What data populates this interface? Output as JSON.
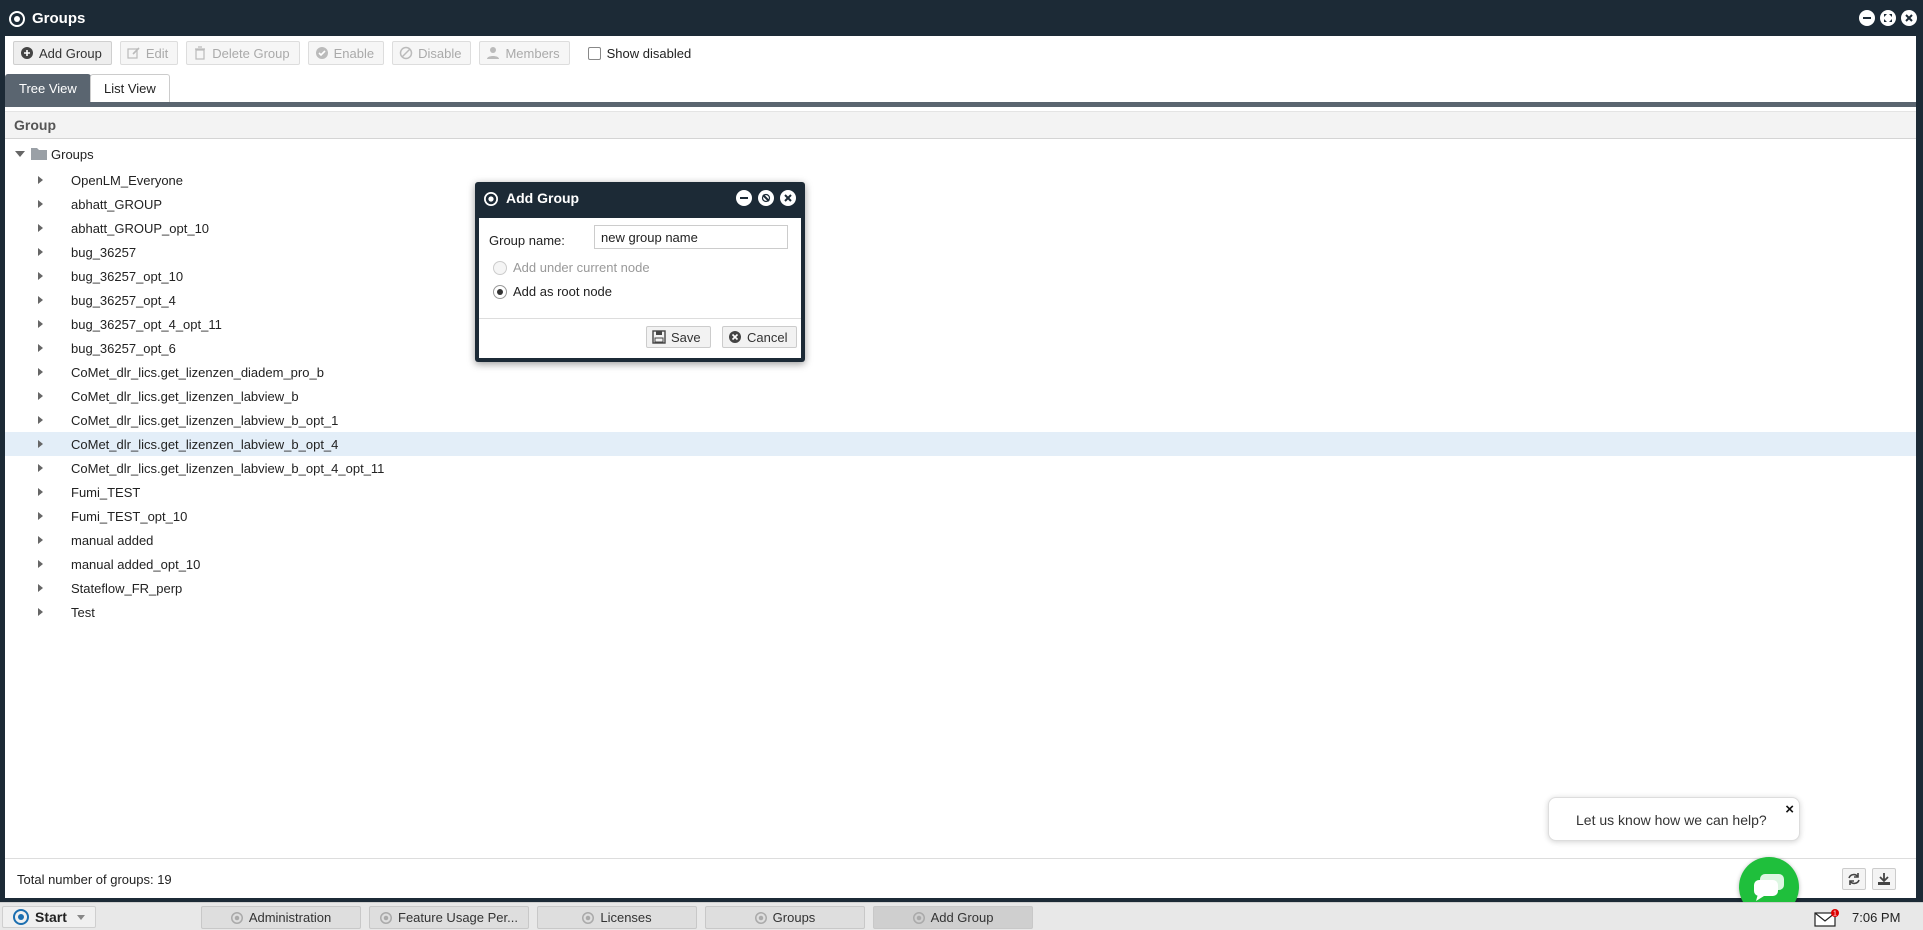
{
  "window": {
    "title": "Groups"
  },
  "toolbar": {
    "add_group": "Add Group",
    "edit": "Edit",
    "delete_group": "Delete Group",
    "enable": "Enable",
    "disable": "Disable",
    "members": "Members",
    "show_disabled": "Show disabled"
  },
  "tabs": {
    "tree_view": "Tree View",
    "list_view": "List View"
  },
  "grid": {
    "column_header": "Group"
  },
  "tree": {
    "root_label": "Groups",
    "items": [
      "OpenLM_Everyone",
      "abhatt_GROUP",
      "abhatt_GROUP_opt_10",
      "bug_36257",
      "bug_36257_opt_10",
      "bug_36257_opt_4",
      "bug_36257_opt_4_opt_11",
      "bug_36257_opt_6",
      "CoMet_dlr_lics.get_lizenzen_diadem_pro_b",
      "CoMet_dlr_lics.get_lizenzen_labview_b",
      "CoMet_dlr_lics.get_lizenzen_labview_b_opt_1",
      "CoMet_dlr_lics.get_lizenzen_labview_b_opt_4",
      "CoMet_dlr_lics.get_lizenzen_labview_b_opt_4_opt_11",
      "Fumi_TEST",
      "Fumi_TEST_opt_10",
      "manual added",
      "manual added_opt_10",
      "Stateflow_FR_perp",
      "Test"
    ],
    "highlighted": "CoMet_dlr_lics.get_lizenzen_labview_b_opt_4"
  },
  "footer": {
    "total": "Total number of groups: 19"
  },
  "dialog": {
    "title": "Add Group",
    "group_name_label": "Group name:",
    "group_name_value": "new group name",
    "option_current": "Add under current node",
    "option_root": "Add as root node",
    "save": "Save",
    "cancel": "Cancel"
  },
  "chat": {
    "prompt": "Let us know how we can help?",
    "close": "×"
  },
  "taskbar": {
    "start": "Start",
    "tasks": [
      "Administration",
      "Feature Usage Per...",
      "Licenses",
      "Groups",
      "Add Group"
    ],
    "time": "7:06 PM",
    "mail_badge": "1"
  },
  "colors": {
    "titlebar": "#1c2a36",
    "tab_selected": "#5a6570",
    "highlight_row": "#e3eef8",
    "chat_green": "#1fbf3c"
  }
}
